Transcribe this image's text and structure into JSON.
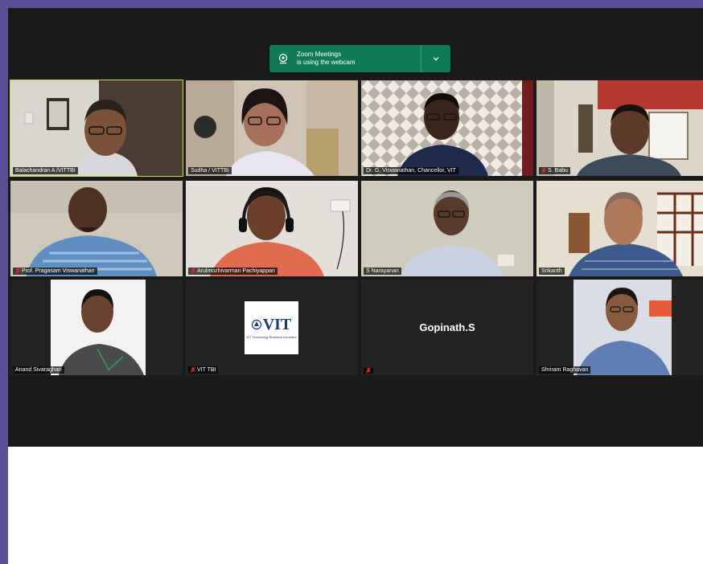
{
  "banner": {
    "line1": "Zoom Meetings",
    "line2": "is using the webcam",
    "icon": "webcam-icon",
    "chevron": "chevron-down-icon"
  },
  "participants": [
    {
      "name": "Balachandran A /VITTBI",
      "muted": false,
      "active": true
    },
    {
      "name": "Sudha / VITTBI",
      "muted": false,
      "active": false
    },
    {
      "name": "Dr. G. Viswanathan, Chancellor, VIT",
      "muted": false,
      "active": false
    },
    {
      "name": "S. Babu",
      "muted": true,
      "active": false
    },
    {
      "name": "Prof. Pragasam Viswanathan",
      "muted": true,
      "active": false
    },
    {
      "name": "Arulmozhivarman Pachiyappan",
      "muted": true,
      "active": false
    },
    {
      "name": "S Narayanan",
      "muted": false,
      "active": false
    },
    {
      "name": "Srikanth",
      "muted": false,
      "active": false
    },
    {
      "name": "Anand Sivaraghan",
      "muted": false,
      "active": false
    },
    {
      "name": "VIT TBI",
      "muted": true,
      "active": false,
      "logo_text": "VIT",
      "logo_sub": "VIT Technology Business Incubator"
    },
    {
      "name": "",
      "muted": true,
      "active": false,
      "display_text": "Gopinath.S"
    },
    {
      "name": "Shriram Raghavan",
      "muted": false,
      "active": false
    }
  ],
  "colors": {
    "active_border": "#c4dd4d",
    "banner_bg": "#0f7a56",
    "mute_red": "#e02828"
  }
}
